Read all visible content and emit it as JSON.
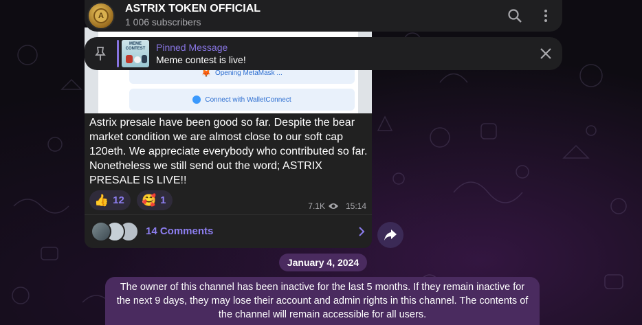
{
  "channel": {
    "name": "ASTRIX TOKEN OFFICIAL",
    "subscribers": "1 006 subscribers",
    "avatar_letter": "A"
  },
  "header_icons": [
    "search-icon",
    "more-vertical-icon"
  ],
  "pinned": {
    "label": "Pinned Message",
    "text": "Meme contest is live!",
    "thumb_caption": "MEME CONTEST"
  },
  "message": {
    "image": {
      "button1": "Opening MetaMask ...",
      "button2": "Connect with WalletConnect"
    },
    "text": "Astrix presale have been good so far. Despite the bear market condition we are almost close to our soft cap 120eth. We appreciate everybody who contributed so far. Nonetheless we still send out the word; ASTRIX PRESALE IS LIVE!!",
    "reactions": [
      {
        "emoji": "👍",
        "count": "12"
      },
      {
        "emoji": "🥰",
        "count": "1"
      }
    ],
    "views": "7.1K",
    "time": "15:14",
    "comments_label": "14 Comments"
  },
  "date_badge": "January 4, 2024",
  "notice": "The owner of this channel has been inactive for the last 5 months. If they remain inactive for the next 9 days, they may lose their account and admin rights in this channel. The contents of the channel will remain accessible for all users.",
  "colors": {
    "accent": "#8774e1",
    "bubble": "#212121",
    "service_bg": "#4a2b5f"
  }
}
